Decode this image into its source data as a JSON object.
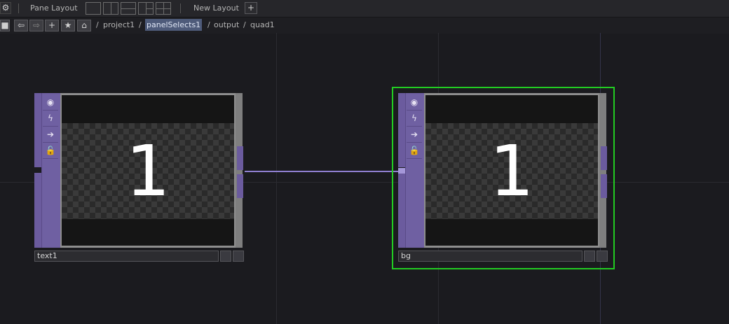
{
  "toolbar": {
    "pane_layout_label": "Pane Layout",
    "new_layout_label": "New Layout",
    "add_glyph": "+"
  },
  "breadcrumb": {
    "separator": "/",
    "items": [
      "project1",
      "panelSelects1",
      "output",
      "quad1"
    ],
    "selected_index": 1
  },
  "nodes": {
    "text1": {
      "name": "text1",
      "preview_value": "1",
      "selected": false
    },
    "bg": {
      "name": "bg",
      "preview_value": "1",
      "selected": true
    }
  },
  "colors": {
    "selection_border": "#22cc22",
    "operator_strip": "#6b5b9e",
    "wire": "#8f7fd0",
    "breadcrumb_highlight": "#4e5b7a"
  }
}
